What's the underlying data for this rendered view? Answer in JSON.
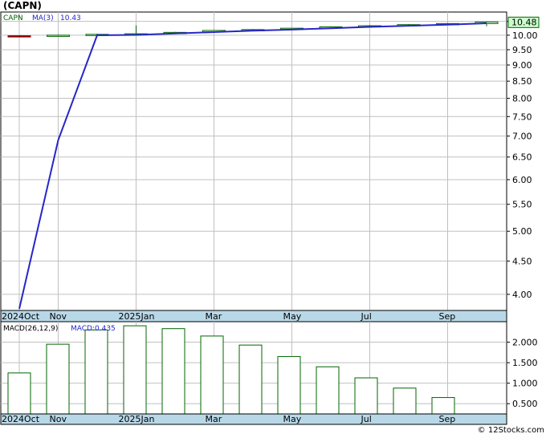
{
  "title": "(CAPN)",
  "footer": "© 12Stocks.com",
  "colors": {
    "ma_line": "#2626c8",
    "bar_up": "#006400",
    "bar_down": "#8b0000",
    "macd_bar": "#006400",
    "axis_strip": "#b8d8e8",
    "grid": "#c0c0c0",
    "last_price_box": "#ccffcc"
  },
  "chart_data": [
    {
      "type": "line",
      "panel": "price",
      "legend": {
        "ticker": "CAPN",
        "ma_label": "MA(3)",
        "ma_value": "10.43"
      },
      "last_price_label": "10.48",
      "x_labels": [
        "2024Oct",
        "Nov",
        "2025Jan",
        "Mar",
        "May",
        "Jul",
        "Sep"
      ],
      "y_ticks": [
        "10.50",
        "10.00",
        "9.50",
        "9.00",
        "8.50",
        "8.00",
        "7.50",
        "7.00",
        "6.50",
        "6.00",
        "5.50",
        "5.00",
        "4.50",
        "4.00"
      ],
      "ylim": [
        3.8,
        10.55
      ],
      "scale": "log",
      "grid": true,
      "x": [
        "2024-10",
        "2024-11",
        "2024-12",
        "2025-01",
        "2025-02",
        "2025-03",
        "2025-04",
        "2025-05",
        "2025-06",
        "2025-07",
        "2025-08",
        "2025-09",
        "2025-10"
      ],
      "monthly_bars": [
        {
          "open": 9.98,
          "close": 9.96,
          "high": 10.0,
          "low": 9.95
        },
        {
          "open": 9.99,
          "close": 10.0,
          "high": 10.02,
          "low": 9.97
        },
        {
          "open": 10.0,
          "close": 10.03,
          "high": 10.05,
          "low": 9.99
        },
        {
          "open": 10.03,
          "close": 10.05,
          "high": 10.35,
          "low": 10.02
        },
        {
          "open": 10.06,
          "close": 10.1,
          "high": 10.12,
          "low": 10.05
        },
        {
          "open": 10.12,
          "close": 10.17,
          "high": 10.19,
          "low": 10.1
        },
        {
          "open": 10.17,
          "close": 10.2,
          "high": 10.22,
          "low": 10.16
        },
        {
          "open": 10.21,
          "close": 10.25,
          "high": 10.26,
          "low": 10.2
        },
        {
          "open": 10.26,
          "close": 10.3,
          "high": 10.32,
          "low": 10.25
        },
        {
          "open": 10.3,
          "close": 10.34,
          "high": 10.36,
          "low": 10.29
        },
        {
          "open": 10.35,
          "close": 10.38,
          "high": 10.4,
          "low": 10.34
        },
        {
          "open": 10.38,
          "close": 10.42,
          "high": 10.44,
          "low": 10.37
        },
        {
          "open": 10.42,
          "close": 10.48,
          "high": 10.5,
          "low": 10.32
        }
      ],
      "series": [
        {
          "name": "MA(3)",
          "values": [
            3.8,
            6.9,
            10.0,
            10.01,
            10.06,
            10.11,
            10.16,
            10.2,
            10.25,
            10.3,
            10.34,
            10.38,
            10.43
          ]
        }
      ]
    },
    {
      "type": "bar",
      "panel": "macd",
      "legend": {
        "label": "MACD(26,12,9)",
        "value_label": "MACD:0.435"
      },
      "x_labels": [
        "2024Oct",
        "Nov",
        "2025Jan",
        "Mar",
        "May",
        "Jul",
        "Sep"
      ],
      "y_ticks": [
        "2.000",
        "1.500",
        "1.000",
        "0.500"
      ],
      "ylim": [
        0.25,
        2.5
      ],
      "grid": true,
      "x": [
        "2024-10",
        "2024-11",
        "2024-12",
        "2025-01",
        "2025-02",
        "2025-03",
        "2025-04",
        "2025-05",
        "2025-06",
        "2025-07",
        "2025-08",
        "2025-09"
      ],
      "values": [
        1.25,
        1.95,
        2.3,
        2.4,
        2.33,
        2.15,
        1.93,
        1.65,
        1.4,
        1.13,
        0.88,
        0.65
      ]
    }
  ]
}
